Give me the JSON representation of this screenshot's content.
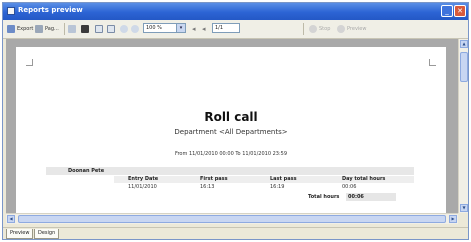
{
  "window": {
    "title": "Reports preview"
  },
  "toolbar": {
    "export_label": "Export",
    "page_setup_label": "Pag...",
    "zoom_value": "100 %",
    "page_value": "1/1",
    "stop_label": "Stop",
    "prev_label": "Preview"
  },
  "report": {
    "title": "Roll call",
    "department": "Department <All Departments>",
    "range": "From 11/01/2010 00:00   To 11/01/2010 23:59",
    "person": "Doonan Pete",
    "columns": [
      "Entry Date",
      "First pass",
      "Last pass",
      "Day total hours"
    ],
    "row": [
      "11/01/2010",
      "16:13",
      "16:19",
      "00:06"
    ],
    "total_label": "Total hours",
    "total_value": "00:06"
  },
  "tabs": [
    "Preview",
    "Design"
  ],
  "colors": {
    "titlebar": "#2c64d4",
    "workspace": "#a9a9a9"
  }
}
